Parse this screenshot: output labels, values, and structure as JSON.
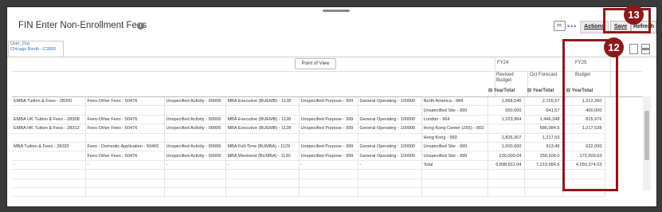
{
  "header": {
    "title": "FIN Enter Non-Enrollment Fees",
    "info_icon": "i",
    "more_dots": "•••",
    "actions_label": "Actions",
    "save_label": "Save",
    "refresh_label": "Refresh"
  },
  "tab": {
    "line1": "User_Org",
    "line2": "Chicago Booth - C2800"
  },
  "pov_label": "Point of View",
  "columns": {
    "fy24": "FY24",
    "fy25": "FY25",
    "revised_budget_1": "Revised",
    "revised_budget_2": "Budget",
    "oct_forecast": "Oct Forecast",
    "budget": "Budget",
    "yeartotal": "YearTotal"
  },
  "rows": [
    {
      "c1": "EMBA Tuition & Fees - 28300",
      "c2": "Fees-Other Fees - 50476",
      "c3": "Unspecified Activity - 99999",
      "c4": "MBA Executive (BUEMB) - 1128",
      "c5": "Unspecified Purpose - 999",
      "c6": "General Operating - 100000",
      "c7": "North America - 984",
      "v1": "1,968,540",
      "v2": "2,155,57",
      "v3": "1,312,360"
    },
    {
      "c1": "",
      "c2": "",
      "c3": "",
      "c4": "",
      "c5": "",
      "c6": "",
      "c7": "Unspecified Site - 999",
      "v1": "650,000",
      "v2": "641,57",
      "v3": "400,000"
    },
    {
      "c1": "EMBA UK Tuition & Fees - 28308",
      "c2": "Fees-Other Fees - 50476",
      "c3": "Unspecified Activity - 99999",
      "c4": "MBA Executive (BUEMB) - 1128",
      "c5": "Unspecified Purpose - 999",
      "c6": "General Operating - 100000",
      "c7": "London - 964",
      "v1": "1,223,964",
      "v2": "1,446,348",
      "v3": "815,976"
    },
    {
      "c1": "EMBA HK Tuition & Fees - 28312",
      "c2": "Fees-Other Fees - 50476",
      "c3": "Unspecified Activity - 99999",
      "c4": "MBA Executive (BUEMB) - 1128",
      "c5": "Unspecified Purpose - 999",
      "c6": "General Operating - 100000",
      "c7": "Hong Kong Center (Z65) - 903",
      "v1": "",
      "v2": "586,984.5",
      "v3": "1,217,538"
    },
    {
      "c1": "",
      "c2": "",
      "c3": "",
      "c4": "",
      "c5": "",
      "c6": "",
      "c7": "Hong Kong - 960",
      "v1": "1,826,307",
      "v2": "1,217,53",
      "v3": ""
    },
    {
      "c1": "MBA Tuition & Fees - 28320",
      "c2": "Fees - Domestic Application - 50465",
      "c3": "Unspecified Activity - 99999",
      "c4": "MBA Full-Time (BUMBA) - 1129",
      "c5": "Unspecified Purpose - 999",
      "c6": "General Operating - 100000",
      "c7": "Unspecified Site - 999",
      "v1": "1,000,000",
      "v2": "913,46",
      "v3": "632,000"
    },
    {
      "c1": "",
      "c2": "Fees-Other Fees - 50476",
      "c3": "Unspecified Activity - 99999",
      "c4": "MBA Weekend (BUMBA) - 1130",
      "c5": "Unspecified Purpose - 999",
      "c6": "General Operating - 100000",
      "c7": "Unspecified Site - 999",
      "v1": "230,000.04",
      "v2": "258,500.0",
      "v3": "172,500.03"
    },
    {
      "c1": "-",
      "c2": "-",
      "c3": "-",
      "c4": "-",
      "c5": "-",
      "c6": "-",
      "c7": "Total",
      "v1": "6,898,811.04",
      "v2": "7,219,984.6",
      "v3": "4,550,374.03"
    },
    {
      "c1": "",
      "c2": "",
      "c3": "",
      "c4": "",
      "c5": "",
      "c6": "",
      "c7": "",
      "v1": "",
      "v2": "",
      "v3": ""
    },
    {
      "c1": "",
      "c2": "",
      "c3": "",
      "c4": "",
      "c5": "",
      "c6": "",
      "c7": "",
      "v1": "",
      "v2": "",
      "v3": ""
    },
    {
      "c1": "",
      "c2": "",
      "c3": "",
      "c4": "",
      "c5": "",
      "c6": "",
      "c7": "",
      "v1": "",
      "v2": "",
      "v3": ""
    }
  ],
  "callouts": {
    "save_step": "13",
    "budget_step": "12",
    "color": "#8b1a1a"
  }
}
